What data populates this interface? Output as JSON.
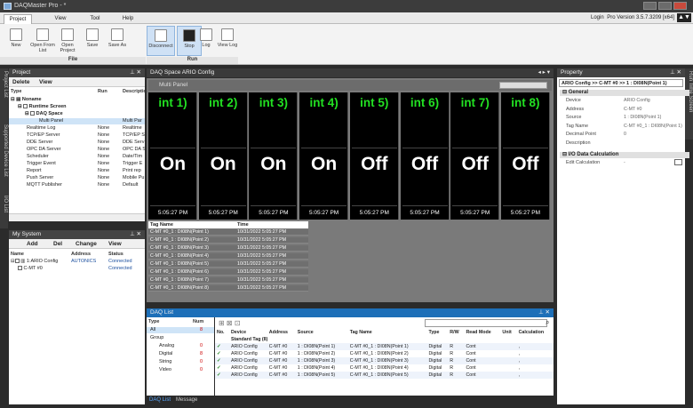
{
  "window": {
    "title": "DAQMaster Pro - *"
  },
  "menu": {
    "tabs": [
      "Project",
      "View",
      "Tool",
      "Help"
    ],
    "login": "Login",
    "version": "Pro Version 3.5.7.3209 [x64]"
  },
  "ribbon": {
    "file_group": "File",
    "run_group": "Run",
    "buttons": [
      "New",
      "Open From List",
      "Open Project",
      "Save",
      "Save As",
      "Disconnect",
      "Stop",
      "Log",
      "View Log"
    ]
  },
  "side_tabs": {
    "left": [
      "Project List",
      "Supported Device List",
      "I/O List"
    ],
    "right": "Run Time Screen"
  },
  "project": {
    "title": "Project",
    "delete": "Delete",
    "view": "View",
    "columns": [
      "Type",
      "Run",
      "Descriptio"
    ],
    "root": "Noname",
    "runtime": "Runtime Screen",
    "daqspace": "DAQ Space",
    "items": [
      {
        "name": "Multi Panel",
        "run": "",
        "desc": "Multi Par"
      },
      {
        "name": "Realtime Log",
        "run": "None",
        "desc": "Realtime"
      },
      {
        "name": "TCP/EP Server",
        "run": "None",
        "desc": "TCP/EP S"
      },
      {
        "name": "DDE Server",
        "run": "None",
        "desc": "DDE Serv"
      },
      {
        "name": "OPC DA Server",
        "run": "None",
        "desc": "OPC DA S"
      },
      {
        "name": "Scheduler",
        "run": "None",
        "desc": "Date/Tim"
      },
      {
        "name": "Trigger Event",
        "run": "None",
        "desc": "Trigger E"
      },
      {
        "name": "Report",
        "run": "None",
        "desc": "Print rep"
      },
      {
        "name": "Push Server",
        "run": "None",
        "desc": "Mobile Pu"
      },
      {
        "name": "MQTT Publisher",
        "run": "None",
        "desc": "Default"
      }
    ]
  },
  "mysystem": {
    "title": "My System",
    "buttons": [
      "Add",
      "Del",
      "Change",
      "View"
    ],
    "columns": [
      "Name",
      "Address",
      "Status"
    ],
    "rows": [
      {
        "name": "1:ARIO Config",
        "address": "AUTONICS",
        "status": "Connected"
      },
      {
        "name": "C-MT #0",
        "address": "",
        "status": "Connected"
      }
    ]
  },
  "daqspace": {
    "title": "DAQ Space  ARIO Config",
    "panel": "Multi Panel",
    "tiles": [
      {
        "name": "int 1)",
        "value": "On",
        "time": "5:05:27 PM"
      },
      {
        "name": "int 2)",
        "value": "On",
        "time": "5:05:27 PM"
      },
      {
        "name": "int 3)",
        "value": "On",
        "time": "5:05:27 PM"
      },
      {
        "name": "int 4)",
        "value": "On",
        "time": "5:05:27 PM"
      },
      {
        "name": "int 5)",
        "value": "Off",
        "time": "5:05:27 PM"
      },
      {
        "name": "int 6)",
        "value": "Off",
        "time": "5:05:27 PM"
      },
      {
        "name": "int 7)",
        "value": "Off",
        "time": "5:05:27 PM"
      },
      {
        "name": "int 8)",
        "value": "Off",
        "time": "5:05:27 PM"
      }
    ],
    "log_columns": [
      "Tag Name",
      "Time"
    ],
    "log": [
      {
        "tag": "C-MT #0_1 : DI08N(Point 1)",
        "time": "10/31/2022 5:05:27 PM"
      },
      {
        "tag": "C-MT #0_1 : DI08N(Point 2)",
        "time": "10/31/2022 5:05:27 PM"
      },
      {
        "tag": "C-MT #0_1 : DI08N(Point 3)",
        "time": "10/31/2022 5:05:27 PM"
      },
      {
        "tag": "C-MT #0_1 : DI08N(Point 4)",
        "time": "10/31/2022 5:05:27 PM"
      },
      {
        "tag": "C-MT #0_1 : DI08N(Point 5)",
        "time": "10/31/2022 5:05:27 PM"
      },
      {
        "tag": "C-MT #0_1 : DI08N(Point 6)",
        "time": "10/31/2022 5:05:27 PM"
      },
      {
        "tag": "C-MT #0_1 : DI08N(Point 7)",
        "time": "10/31/2022 5:05:27 PM"
      },
      {
        "tag": "C-MT #0_1 : DI08N(Point 8)",
        "time": "10/31/2022 5:05:27 PM"
      }
    ]
  },
  "property": {
    "title": "Property",
    "path": "ARIO Config >> C-MT #0 >> 1 : DI08N(Point 1)",
    "general": "General",
    "fields": [
      {
        "label": "Device",
        "value": "ARIO Config"
      },
      {
        "label": "Address",
        "value": "C-MT #0"
      },
      {
        "label": "Source",
        "value": "1 : DI08N(Point 1)"
      },
      {
        "label": "Tag Name",
        "value": "C-MT #0_1 : DI08N(Point 1)"
      },
      {
        "label": "Decimal Point",
        "value": "0"
      },
      {
        "label": "Description",
        "value": ""
      }
    ],
    "io": "I/O Data Calculation",
    "edit_calc": "Edit Calculation",
    "edit_val": "-"
  },
  "daqlist": {
    "title": "DAQ List",
    "type_col": "Type",
    "num_col": "Num",
    "types": [
      {
        "name": "All",
        "num": "8"
      },
      {
        "name": "Group",
        "num": ""
      },
      {
        "name": "Analog",
        "num": "0"
      },
      {
        "name": "Digital",
        "num": "8"
      },
      {
        "name": "String",
        "num": "0"
      },
      {
        "name": "Video",
        "num": "0"
      }
    ],
    "columns": [
      "No.",
      "Device",
      "Address",
      "Source",
      "Tag Name",
      "Type",
      "R/W",
      "Read Mode",
      "Unit",
      "Calculation"
    ],
    "group": "Standard Tag (8)",
    "rows": [
      {
        "device": "ARIO Config",
        "address": "C-MT #0",
        "source": "1 : DI08N(Point 1)",
        "tag": "C-MT #0_1 : DI08N(Point 1)",
        "type": "Digital",
        "rw": "R",
        "mode": "Cont",
        "unit": "",
        "calc": ","
      },
      {
        "device": "ARIO Config",
        "address": "C-MT #0",
        "source": "1 : DI08N(Point 2)",
        "tag": "C-MT #0_1 : DI08N(Point 2)",
        "type": "Digital",
        "rw": "R",
        "mode": "Cont",
        "unit": "",
        "calc": ","
      },
      {
        "device": "ARIO Config",
        "address": "C-MT #0",
        "source": "1 : DI08N(Point 3)",
        "tag": "C-MT #0_1 : DI08N(Point 3)",
        "type": "Digital",
        "rw": "R",
        "mode": "Cont",
        "unit": "",
        "calc": ","
      },
      {
        "device": "ARIO Config",
        "address": "C-MT #0",
        "source": "1 : DI08N(Point 4)",
        "tag": "C-MT #0_1 : DI08N(Point 4)",
        "type": "Digital",
        "rw": "R",
        "mode": "Cont",
        "unit": "",
        "calc": ","
      },
      {
        "device": "ARIO Config",
        "address": "C-MT #0",
        "source": "1 : DI08N(Point 5)",
        "tag": "C-MT #0_1 : DI08N(Point 5)",
        "type": "Digital",
        "rw": "R",
        "mode": "Cont",
        "unit": "",
        "calc": ","
      }
    ],
    "bottom_tabs": [
      "DAQ List",
      "Message"
    ]
  }
}
